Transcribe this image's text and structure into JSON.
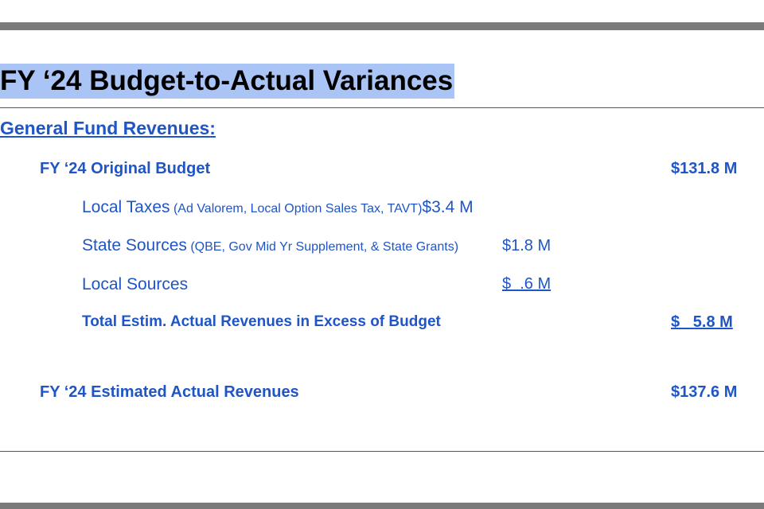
{
  "title": "FY ‘24 Budget-to-Actual Variances",
  "section_heading": "General Fund Revenues:",
  "original_budget": {
    "label": "FY ‘24 Original Budget",
    "amount": "$131.8 M"
  },
  "local_taxes": {
    "label": "Local Taxes",
    "detail": " (Ad Valorem, Local Option Sales Tax, TAVT)",
    "amount": "$3.4 M"
  },
  "state_sources": {
    "label": "State Sources",
    "detail": " (QBE, Gov Mid Yr Supplement, & State Grants)",
    "amount": "$1.8 M"
  },
  "local_sources": {
    "label": "Local Sources",
    "amount": "$  .6 M"
  },
  "total_excess": {
    "label": "Total Estim. Actual Revenues in Excess of Budget",
    "amount": "$   5.8 M"
  },
  "estimated_actual": {
    "label": "FY ‘24 Estimated Actual Revenues",
    "amount": "$137.6 M"
  }
}
